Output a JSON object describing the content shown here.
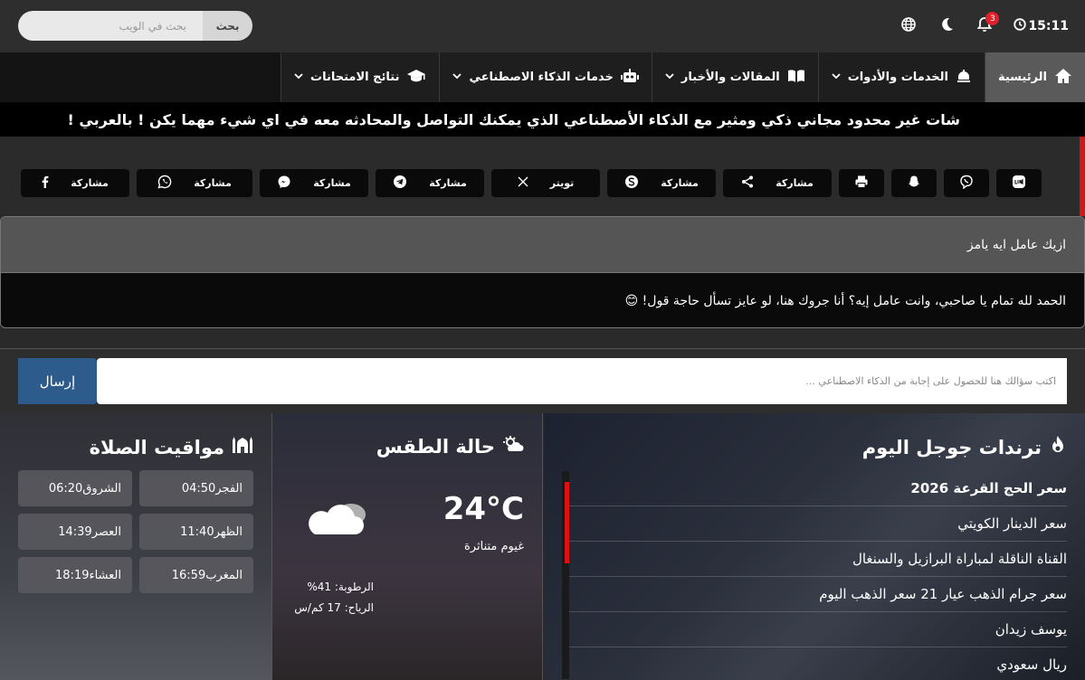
{
  "topbar": {
    "time": "15:11",
    "notifications_count": "3",
    "search_placeholder": "بحث في الويب",
    "search_button": "بحث"
  },
  "nav": {
    "items": [
      {
        "label": "الرئيسية",
        "icon": "home-icon"
      },
      {
        "label": "الخدمات والأدوات",
        "icon": "bell-service-icon"
      },
      {
        "label": "المقالات والأخبار",
        "icon": "book-icon"
      },
      {
        "label": "خدمات الذكاء الاصطناعي",
        "icon": "robot-icon"
      },
      {
        "label": "نتائج الامتحانات",
        "icon": "graduation-cap-icon"
      }
    ]
  },
  "ticker": {
    "text": "شات غير محدود مجاني ذكي ومثير مع الذكاء الأصطناعي الذي يمكنك التواصل والمحادثه معه في اي شيء مهما يكن ! بالعربي !"
  },
  "share": {
    "buttons": [
      {
        "label": "",
        "icon": "line-icon"
      },
      {
        "label": "",
        "icon": "viber-icon"
      },
      {
        "label": "",
        "icon": "snapchat-icon"
      },
      {
        "label": "",
        "icon": "print-icon"
      },
      {
        "label": "مشاركة",
        "icon": "share-icon"
      },
      {
        "label": "مشاركة",
        "icon": "skype-icon"
      },
      {
        "label": "تويتر",
        "icon": "x-icon"
      },
      {
        "label": "مشاركة",
        "icon": "telegram-icon"
      },
      {
        "label": "مشاركة",
        "icon": "messenger-icon"
      },
      {
        "label": "مشاركة",
        "icon": "whatsapp-icon"
      },
      {
        "label": "مشاركة",
        "icon": "facebook-icon"
      }
    ]
  },
  "chat": {
    "user_message": "ازيك عامل ايه يامز",
    "bot_message": "الحمد لله تمام يا صاحبي، وانت عامل إيه؟ أنا جروك هنا، لو عايز تسأل حاجة قول! 😊",
    "input_placeholder": "اكتب سؤالك هنا للحصول على إجابة من الذكاء الاصطناعي ...",
    "send_button": "إرسال"
  },
  "trends": {
    "title": "ترندات جوجل اليوم",
    "items": [
      "سعر الحج القرعة 2026",
      "سعر الدينار الكويتي",
      "القناة الناقلة لمباراة البرازيل والسنغال",
      "سعر جرام الذهب عيار 21 سعر الذهب اليوم",
      "يوسف زيدان",
      "ريال سعودي"
    ]
  },
  "weather": {
    "title": "حالة الطقس",
    "temperature": "24°C",
    "condition": "غيوم متناثرة",
    "humidity": "الرطوبة: 41%",
    "wind": "الرياح: 17 كم/س"
  },
  "prayer": {
    "title": "مواقيت الصلاة",
    "times": [
      {
        "name": "الفجر",
        "time": "04:50"
      },
      {
        "name": "الشروق",
        "time": "06:20"
      },
      {
        "name": "الظهر",
        "time": "11:40"
      },
      {
        "name": "العصر",
        "time": "14:39"
      },
      {
        "name": "المغرب",
        "time": "16:59"
      },
      {
        "name": "العشاء",
        "time": "18:19"
      }
    ]
  }
}
